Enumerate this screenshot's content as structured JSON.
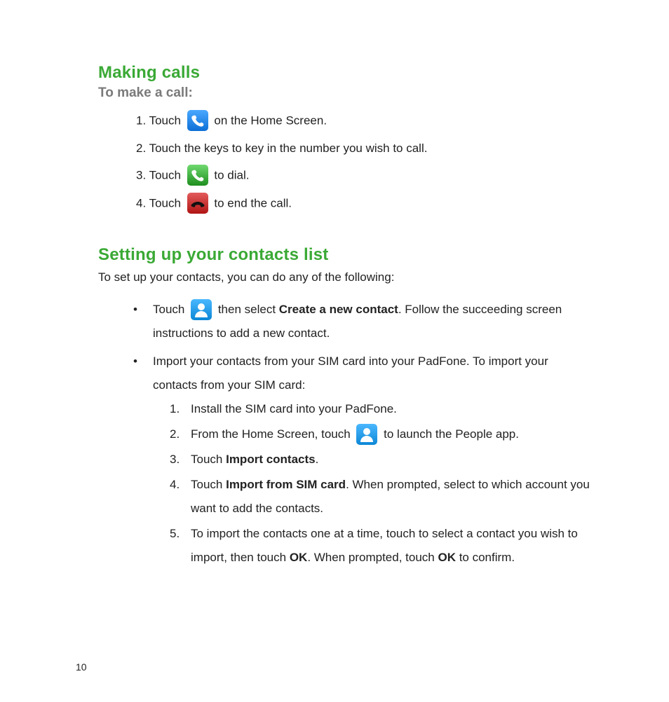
{
  "page_number": "10",
  "section1": {
    "heading": "Making calls",
    "subheading": "To make a call:",
    "steps": {
      "s1_prefix": "1. Touch ",
      "s1_suffix": " on the Home Screen.",
      "s2": "2. Touch the keys to key in the number you wish to call.",
      "s3_prefix": "3. Touch ",
      "s3_suffix": " to dial.",
      "s4_prefix": "4. Touch  ",
      "s4_suffix": " to end the call."
    }
  },
  "section2": {
    "heading": "Setting up your contacts list",
    "intro": "To set up your contacts, you can do any of the following:",
    "bullets": {
      "b1_pre": "Touch ",
      "b1_mid1": " then select ",
      "b1_bold1": "Create a new contact",
      "b1_post1": ". Follow the succeeding screen instructions to add a new contact.",
      "b2": "Import your contacts from your SIM card into your PadFone. To import your contacts from your SIM card:"
    },
    "sublist": {
      "n1": "1.",
      "n2": "2.",
      "n3": "3.",
      "n4": "4.",
      "n5": "5.",
      "i1": "Install the SIM card into your PadFone.",
      "i2_pre": "From the Home Screen, touch ",
      "i2_post": " to launch the People app.",
      "i3_pre": "Touch ",
      "i3_bold": "Import contacts",
      "i3_post": ".",
      "i4_pre": "Touch ",
      "i4_bold": "Import from SIM card",
      "i4_post": ". When prompted, select to which account you want to add the contacts.",
      "i5_pre": "To import the contacts one at a time, touch to select a contact you wish to import, then touch ",
      "i5_bold1": "OK",
      "i5_mid": ". When prompted, touch ",
      "i5_bold2": "OK",
      "i5_post": " to confirm."
    },
    "bullet_char": "•"
  }
}
